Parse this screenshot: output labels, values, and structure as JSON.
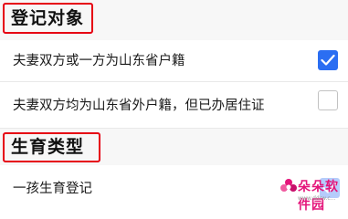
{
  "sections": [
    {
      "title": "登记对象",
      "options": [
        {
          "label": "夫妻双方或一方为山东省户籍",
          "checked": true
        },
        {
          "label": "夫妻双方均为山东省外户籍，但已办居住证",
          "checked": false
        }
      ]
    },
    {
      "title": "生育类型",
      "options": [
        {
          "label": "一孩生育登记",
          "checked": true
        }
      ]
    }
  ],
  "watermark": {
    "text": "朵朵软件园",
    "url": "www.ddrw.c..."
  },
  "colors": {
    "accent": "#2b6ef2",
    "highlight_border": "#e60012",
    "watermark": "#e4147a"
  },
  "icons": {
    "checked": "checkmark-icon",
    "watermark_logo": "flower-logo-icon"
  }
}
